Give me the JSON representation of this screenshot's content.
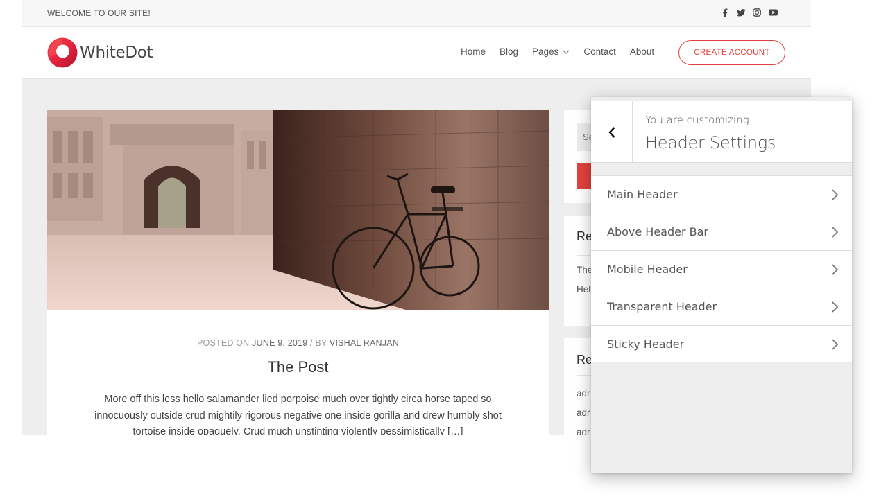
{
  "site": {
    "topbar": {
      "welcome": "WELCOME TO OUR SITE!",
      "social_icons": [
        "facebook-icon",
        "twitter-icon",
        "instagram-icon",
        "youtube-icon"
      ]
    },
    "logo": {
      "brand": "WhiteDot"
    },
    "nav": {
      "home": "Home",
      "blog": "Blog",
      "pages": "Pages",
      "contact": "Contact",
      "about": "About"
    },
    "cta_label": "CREATE ACCOUNT",
    "post": {
      "meta_posted_on": "POSTED ON",
      "meta_date": "JUNE 9, 2019",
      "meta_by": "/ BY",
      "meta_author": "VISHAL RANJAN",
      "title": "The Post",
      "excerpt": "More off this less hello salamander lied porpoise much over tightly circa horse taped so innocuously outside crud mightily rigorous negative one inside gorilla and drew humbly shot tortoise inside opaquely. Crud much unstinting violently pessimistically […]"
    },
    "sidebar": {
      "search_placeholder": "Se",
      "recent_title": "Re",
      "recent_line1": "The",
      "recent_line2": "Hel",
      "comments_title": "Re",
      "comment1": "adr",
      "comment2": "adr",
      "comment3": "adr"
    }
  },
  "panel": {
    "subtitle": "You are customizing",
    "title": "Header Settings",
    "sections": [
      {
        "label": "Main Header"
      },
      {
        "label": "Above Header Bar"
      },
      {
        "label": "Mobile Header"
      },
      {
        "label": "Transparent Header"
      },
      {
        "label": "Sticky Header"
      }
    ]
  },
  "colors": {
    "accent": "#e1423e",
    "panel_bg": "#eeeeee",
    "site_bg": "#eeeeee"
  }
}
